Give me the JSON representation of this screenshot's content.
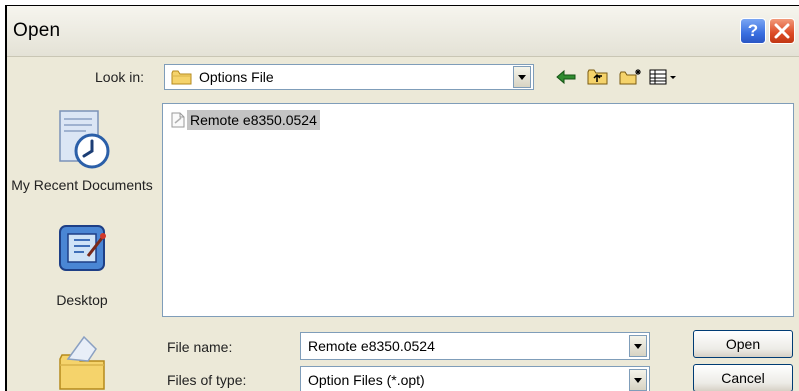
{
  "window": {
    "title": "Open"
  },
  "titlebar_buttons": {
    "help": "?"
  },
  "toolbar": {
    "look_in_label": "Look in:",
    "look_in_value": "Options File",
    "icons": [
      "back-arrow-icon",
      "up-folder-icon",
      "new-folder-icon",
      "view-menu-icon"
    ]
  },
  "places": [
    {
      "label": "My Recent Documents",
      "icon": "recent-documents-icon"
    },
    {
      "label": "Desktop",
      "icon": "desktop-icon"
    },
    {
      "label": "",
      "icon": "my-documents-icon"
    }
  ],
  "files": [
    {
      "name": "Remote e8350.0524",
      "icon": "generic-file-icon",
      "selected": true
    }
  ],
  "form": {
    "file_name_label": "File name:",
    "file_name_value": "Remote e8350.0524",
    "file_type_label": "Files of type:",
    "file_type_value": "Option Files (*.opt)"
  },
  "buttons": {
    "open": "Open",
    "cancel": "Cancel"
  },
  "colors": {
    "selection": "#c4c4c4",
    "titlebar_close": "#dc4a25",
    "titlebar_help": "#3a6fe0"
  }
}
